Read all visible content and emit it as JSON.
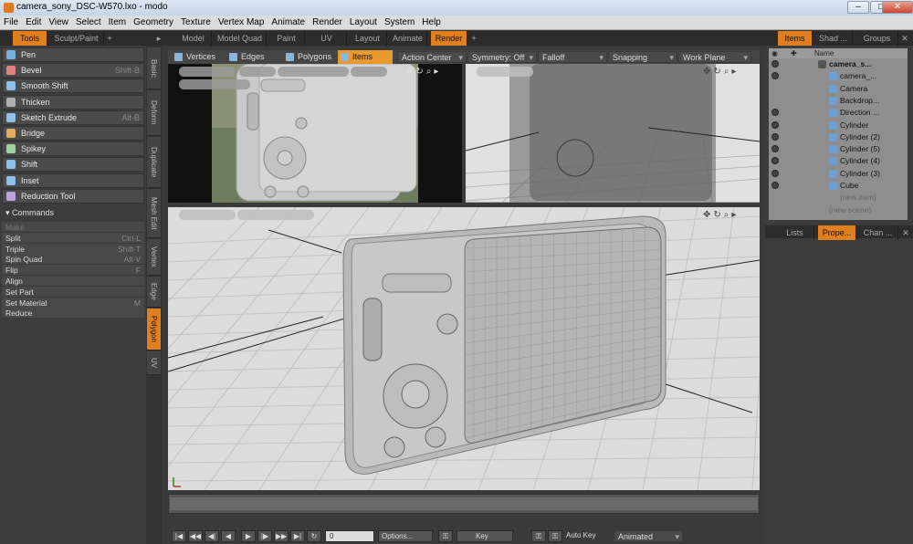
{
  "window": {
    "title": "camera_sony_DSC-W570.lxo - modo",
    "min": "–",
    "max": "□",
    "close": "✕"
  },
  "menu": [
    "File",
    "Edit",
    "View",
    "Select",
    "Item",
    "Geometry",
    "Texture",
    "Vertex Map",
    "Animate",
    "Render",
    "Layout",
    "System",
    "Help"
  ],
  "left_tabs": {
    "tools": "Tools",
    "sculpt": "Sculpt/Paint",
    "plus": "+",
    "arrow": "▸"
  },
  "layout_tabs": [
    "Model",
    "Model Quad",
    "Paint",
    "UV",
    "Layout",
    "Animate",
    "Render",
    "+"
  ],
  "right_tabs": {
    "items": "Items",
    "shad": "Shad ...",
    "groups": "Groups",
    "close": "✕"
  },
  "tools": [
    {
      "label": "Pen",
      "shortcut": ""
    },
    {
      "label": "Bevel",
      "shortcut": "Shift-B"
    },
    {
      "label": "Smooth Shift",
      "shortcut": ""
    },
    {
      "label": "Thicken",
      "shortcut": ""
    },
    {
      "label": "Sketch Extrude",
      "shortcut": "Alt-B"
    },
    {
      "label": "Bridge",
      "shortcut": ""
    },
    {
      "label": "Spikey",
      "shortcut": ""
    },
    {
      "label": "Shift",
      "shortcut": ""
    },
    {
      "label": "Inset",
      "shortcut": ""
    },
    {
      "label": "Reduction Tool",
      "shortcut": ""
    }
  ],
  "commands_header": "Commands",
  "commands": [
    {
      "label": "Make",
      "shortcut": ""
    },
    {
      "label": "Split",
      "shortcut": "Ctrl-L"
    },
    {
      "label": "Triple",
      "shortcut": "Shift-T"
    },
    {
      "label": "Spin Quad",
      "shortcut": "Alt-V"
    },
    {
      "label": "Flip",
      "shortcut": "F"
    },
    {
      "label": "Align",
      "shortcut": ""
    },
    {
      "label": "Set Part",
      "shortcut": ""
    },
    {
      "label": "Set Material",
      "shortcut": "M"
    },
    {
      "label": "Reduce",
      "shortcut": ""
    }
  ],
  "vertical_tabs": [
    "Basic",
    "Deform",
    "Duplicate",
    "Mesh Edit",
    "Vertex",
    "Edge",
    "Polygon",
    "UV"
  ],
  "viewport_toolbar": {
    "modes": [
      "Vertices",
      "Edges",
      "Polygons",
      "Items"
    ],
    "action_center": "Action Center",
    "symmetry": "Symmetry: Off",
    "falloff": "Falloff",
    "snapping": "Snapping",
    "work_plane": "Work Plane"
  },
  "items_header": {
    "name": "Name"
  },
  "items": [
    {
      "label": "camera_s...",
      "indent": 0
    },
    {
      "label": "camera_...",
      "indent": 1
    },
    {
      "label": "Camera",
      "indent": 1
    },
    {
      "label": "Backdrop...",
      "indent": 1
    },
    {
      "label": "Direction ...",
      "indent": 1
    },
    {
      "label": "Cylinder",
      "indent": 1
    },
    {
      "label": "Cylinder (2)",
      "indent": 1
    },
    {
      "label": "Cylinder (5)",
      "indent": 1
    },
    {
      "label": "Cylinder (4)",
      "indent": 1
    },
    {
      "label": "Cylinder (3)",
      "indent": 1
    },
    {
      "label": "Cube",
      "indent": 1
    },
    {
      "label": "(new item)",
      "indent": 1
    },
    {
      "label": "(new scene)",
      "indent": 0
    }
  ],
  "lower_right_tabs": [
    "Lists",
    "Prope...",
    "Chan ...",
    "✕"
  ],
  "transport": {
    "frame": "0",
    "options": "Options...",
    "key": "Key",
    "autokey": "Auto Key",
    "animated": "Animated"
  }
}
